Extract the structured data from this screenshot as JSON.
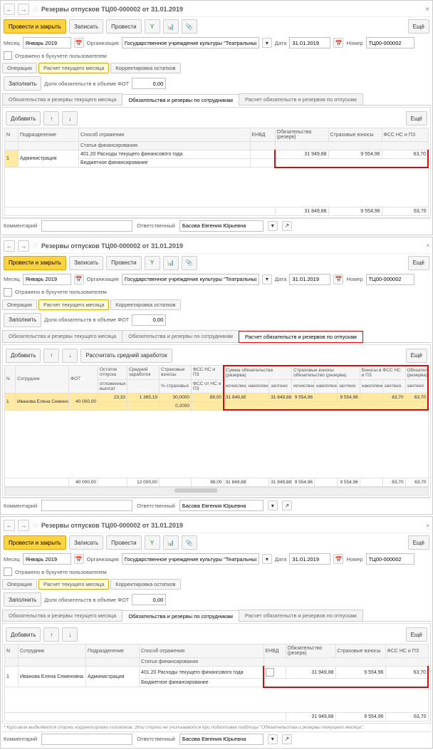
{
  "title": "Резервы отпусков ТЦ00-000002 от 31.01.2019",
  "toolbar": {
    "main": "Провести и закрыть",
    "save": "Записать",
    "post": "Провести",
    "more": "Ещё"
  },
  "hdr": {
    "monthLabel": "Месяц",
    "month": "Январь 2019",
    "orgLabel": "Организация",
    "org": "Государственное учреждение культуры \"Театральный центр\"",
    "dateLabel": "Дата",
    "date": "31.01.2019",
    "numLabel": "Номер",
    "num": "ТЦ00-000002",
    "reflected": "Отражено в бухучете пользователем"
  },
  "optabs": {
    "op": "Операция",
    "calc": "Расчет текущего месяца",
    "corr": "Корректировка остатков"
  },
  "fill": {
    "fill": "Заполнить",
    "share": "Доля обязательств в объеме ФОТ",
    "val": "0,00"
  },
  "docTabs": [
    "Обязательства и резервы текущего месяца",
    "Обязательства и резервы по сотрудникам",
    "Расчет обязательств и резервов по отпускам"
  ],
  "tableBar": {
    "add": "Добавить",
    "avg": "Рассчитать средний заработок"
  },
  "t1": {
    "cols": {
      "n": "N",
      "dept": "Подразделение",
      "method": "Способ отражения",
      "envd": "ЕНВД",
      "oblig": "Обязательства (резерв)",
      "ins": "Страховые взносы",
      "fss": "ФСС НС и ПЗ",
      "stat": "Статья финансирования"
    },
    "row": {
      "n": "1",
      "dept": "Администрация",
      "method": "401.20 Расходы текущего финансового года",
      "stat": "Бюджетное финансирование",
      "oblig": "31 949,88",
      "ins": "9 554,96",
      "fss": "63,70"
    },
    "tot": {
      "oblig": "31 849,88",
      "ins": "9 554,96",
      "fss": "63,70"
    }
  },
  "comment": {
    "label": "Комментарий",
    "respLabel": "Ответственный",
    "resp": "Басова Евгения Юрьевна"
  },
  "t2": {
    "cols": {
      "n": "N",
      "emp": "Сотрудник",
      "fot": "ФОТ",
      "rest": "Остаток отпуска",
      "avg": "Средний заработок",
      "ins": "Страховые взносы",
      "fss": "ФСС НС и ПЗ",
      "sum": "Сумма обязательства (резерва)",
      "insOblig": "Страховые взносы обязательство (резерва)",
      "insRes": "Взносы в ФСС НС и ПЗ",
      "obligRes": "Обязательство (резерва)",
      "days": "отложенных выплат",
      "pct": "% страховых",
      "pctfss": "ФСС от НС и ПЗ",
      "calc": "исчислено",
      "acc": "накоплено",
      "paid": "зачтено"
    },
    "row": {
      "n": "1",
      "emp": "Иванова Елена Семеновна",
      "fot": "40 000,00",
      "rest": "23,33",
      "avg": "1 365,19",
      "ins": "30,0000",
      "pct": "88,00",
      "fss": "0,2000",
      "sum_c": "31 849,88",
      "sum_d": "31 849,88",
      "ins_c": "9 554,96",
      "ins_d": "9 554,96",
      "fs_c": "63,70",
      "fs_d": "63,70"
    },
    "tot": {
      "fot": "40 000,00",
      "avg": "12 000,00",
      "fss": "88,00",
      "sum": "31 849,88",
      "sum2": "31 849,88",
      "ins": "9 554,96",
      "ins2": "9 554,96",
      "fs": "63,70",
      "fs2": "63,70"
    }
  },
  "t3": {
    "cols": {
      "n": "N",
      "emp": "Сотрудник",
      "dept": "Подразделение",
      "method": "Способ отражения",
      "envd": "ЕНВД",
      "oblig": "Обязательство (резерв)",
      "ins": "Страховые взносы",
      "fss": "ФСС НС и ПЗ",
      "stat": "Статья финансирования"
    },
    "row": {
      "n": "1",
      "emp": "Иванова Елена Семеновна",
      "dept": "Администрация",
      "method": "401.20 Расходы текущего финансового года",
      "stat": "Бюджетное финансирование",
      "oblig": "31 949,88",
      "ins": "9 554,96",
      "fss": "63,70"
    },
    "tot": {
      "oblig": "31 949,88",
      "ins": "9 554,96",
      "fss": "63,70"
    }
  },
  "note": "* Курсивом выделяются строки корректировки остатков. Эти строки не учитываются при подготовке таблицы \"Обязательства и резервы текущего месяца\"."
}
